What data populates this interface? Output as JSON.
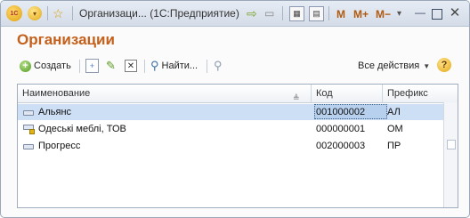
{
  "titlebar": {
    "logo_text": "1С",
    "title": "Организаци... (1С:Предприятие)",
    "m_label": "M",
    "m_plus_label": "M+",
    "m_minus_label": "M−"
  },
  "heading": "Организации",
  "toolbar": {
    "create_label": "Создать",
    "find_label": "Найти...",
    "all_actions_label": "Все действия",
    "help_label": "?"
  },
  "table": {
    "columns": [
      "Наименование",
      "Код",
      "Префикс"
    ],
    "rows": [
      {
        "name": "Альянс",
        "code": "001000002",
        "prefix": "АЛ"
      },
      {
        "name": "Одеські меблі, ТОВ",
        "code": "000000001",
        "prefix": "ОМ"
      },
      {
        "name": "Прогресс",
        "code": "002000003",
        "prefix": "ПР"
      }
    ]
  },
  "colors": {
    "heading": "#c5601a",
    "selected_row": "#cddff4"
  }
}
